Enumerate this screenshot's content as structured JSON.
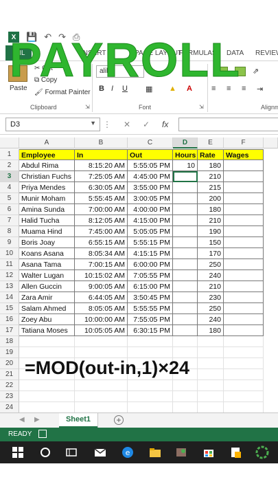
{
  "overlay": {
    "title": "PAYROLL",
    "formula": "=MOD(out-in,1)×24"
  },
  "ribbon": {
    "tab_file": "FIL",
    "tab_insert": "INSERT",
    "tab_page_layout": "PAGE LAYOUT",
    "tab_formulas": "FORMULAS",
    "tab_data": "DATA",
    "tab_review": "REVIEW",
    "cut": "Cut",
    "copy": "Copy",
    "format_painter": "Format Painter",
    "paste": "Paste",
    "group_clipboard": "Clipboard",
    "group_font": "Font",
    "group_alignment": "Alignm",
    "font_name": "alibri"
  },
  "formula_bar": {
    "name_box": "D3",
    "fx": "fx"
  },
  "columns": [
    "A",
    "B",
    "C",
    "D",
    "E",
    "F"
  ],
  "selected_column": "D",
  "header_row": {
    "employee": "Employee",
    "in": "In",
    "out": "Out",
    "hours": "Hours",
    "rate": "Rate",
    "wages": "Wages"
  },
  "rows": [
    {
      "n": "2",
      "employee": "Abdul Rima",
      "in": "8:15:20 AM",
      "out": "5:55:05 PM",
      "hours": "10",
      "rate": "180"
    },
    {
      "n": "3",
      "employee": "Christian Fuchs",
      "in": "7:25:05 AM",
      "out": "4:45:00 PM",
      "hours": "",
      "rate": "210"
    },
    {
      "n": "4",
      "employee": "Priya Mendes",
      "in": "6:30:05 AM",
      "out": "3:55:00 PM",
      "hours": "",
      "rate": "215"
    },
    {
      "n": "5",
      "employee": "Munir Moham",
      "in": "5:55:45 AM",
      "out": "3:00:05 PM",
      "hours": "",
      "rate": "200"
    },
    {
      "n": "6",
      "employee": "Amina Sunda",
      "in": "7:00:00 AM",
      "out": "4:00:00 PM",
      "hours": "",
      "rate": "180"
    },
    {
      "n": "7",
      "employee": "Halid Tucha",
      "in": "8:12:05 AM",
      "out": "4:15:00 PM",
      "hours": "",
      "rate": "210"
    },
    {
      "n": "8",
      "employee": "Muama Hind",
      "in": "7:45:00 AM",
      "out": "5:05:05 PM",
      "hours": "",
      "rate": "190"
    },
    {
      "n": "9",
      "employee": "Boris Joay",
      "in": "6:55:15 AM",
      "out": "5:55:15 PM",
      "hours": "",
      "rate": "150"
    },
    {
      "n": "10",
      "employee": "Koans Asana",
      "in": "8:05:34 AM",
      "out": "4:15:15 PM",
      "hours": "",
      "rate": "170"
    },
    {
      "n": "11",
      "employee": "Asana Tama",
      "in": "7:00:15 AM",
      "out": "6:00:00 PM",
      "hours": "",
      "rate": "250"
    },
    {
      "n": "12",
      "employee": "Walter Lugan",
      "in": "10:15:02 AM",
      "out": "7:05:55 PM",
      "hours": "",
      "rate": "240"
    },
    {
      "n": "13",
      "employee": "Allen Guccin",
      "in": "9:00:05 AM",
      "out": "6:15:00 PM",
      "hours": "",
      "rate": "210"
    },
    {
      "n": "14",
      "employee": "Zara Amir",
      "in": "6:44:05 AM",
      "out": "3:50:45 PM",
      "hours": "",
      "rate": "230"
    },
    {
      "n": "15",
      "employee": "Salam Ahmed",
      "in": "8:05:05 AM",
      "out": "5:55:55 PM",
      "hours": "",
      "rate": "250"
    },
    {
      "n": "16",
      "employee": "Zoey Abu",
      "in": "10:00:00 AM",
      "out": "7:55:05 PM",
      "hours": "",
      "rate": "240"
    },
    {
      "n": "17",
      "employee": "Tatiana Moses",
      "in": "10:05:05 AM",
      "out": "6:30:15 PM",
      "hours": "",
      "rate": "180"
    }
  ],
  "empty_rows": [
    "18",
    "19",
    "20",
    "21",
    "22",
    "23",
    "24"
  ],
  "sheet_tab": "Sheet1",
  "status": "READY",
  "colors": {
    "excel_green": "#217346",
    "title_green": "#2fb62f",
    "header_fill": "#ffff00"
  }
}
